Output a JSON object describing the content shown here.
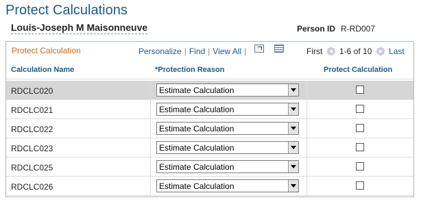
{
  "page": {
    "title": "Protect Calculations",
    "person_name": "Louis-Joseph M Maisonneuve",
    "person_id_label": "Person ID",
    "person_id": "R-RD007"
  },
  "grid": {
    "title": "Protect Calculation",
    "links": {
      "personalize": "Personalize",
      "find": "Find",
      "view_all": "View All"
    },
    "icons": {
      "zoom": "zoom-icon",
      "download": "download-icon",
      "prev": "prev-icon",
      "next": "next-icon"
    },
    "pager": {
      "first": "First",
      "range": "1-6 of 10",
      "last": "Last"
    },
    "columns": [
      "Calculation Name",
      "*Protection Reason",
      "Protect Calculation"
    ],
    "rows": [
      {
        "name": "RDCLC020",
        "reason": "Estimate Calculation",
        "protect": false
      },
      {
        "name": "RDCLC021",
        "reason": "Estimate Calculation",
        "protect": false
      },
      {
        "name": "RDCLC022",
        "reason": "Estimate Calculation",
        "protect": false
      },
      {
        "name": "RDCLC023",
        "reason": "Estimate Calculation",
        "protect": false
      },
      {
        "name": "RDCLC025",
        "reason": "Estimate Calculation",
        "protect": false
      },
      {
        "name": "RDCLC026",
        "reason": "Estimate Calculation",
        "protect": false
      }
    ],
    "selected_row": 0
  },
  "colors": {
    "title": "#1e5a8a",
    "grid_title": "#c46a1c",
    "link": "#1e5a8a",
    "selected_row": "#d6d6d6"
  }
}
